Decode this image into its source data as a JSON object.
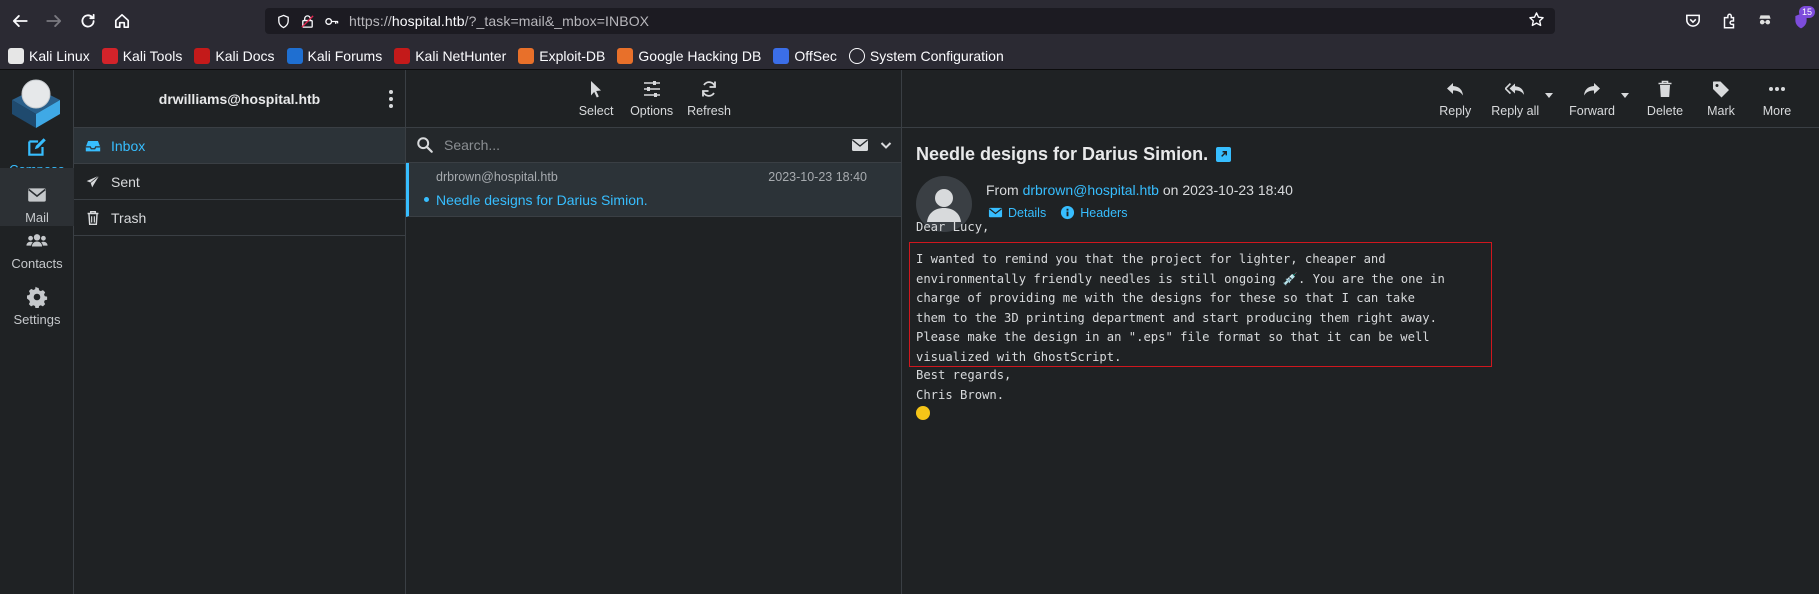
{
  "browser": {
    "url_prefix": "https://",
    "url_host": "hospital.htb",
    "url_path": "/?_task=mail&_mbox=INBOX",
    "extensions_badge": "15",
    "bookmarks": [
      {
        "label": "Kali Linux",
        "color": "#e6e6e6"
      },
      {
        "label": "Kali Tools",
        "color": "#d2232a"
      },
      {
        "label": "Kali Docs",
        "color": "#c41a1a"
      },
      {
        "label": "Kali Forums",
        "color": "#1f6fd1"
      },
      {
        "label": "Kali NetHunter",
        "color": "#c41a1a"
      },
      {
        "label": "Exploit-DB",
        "color": "#e8702a"
      },
      {
        "label": "Google Hacking DB",
        "color": "#e8702a"
      },
      {
        "label": "OffSec",
        "color": "#3b6ee8"
      },
      {
        "label": "System Configuration",
        "color": "#fbfbfe"
      }
    ]
  },
  "rail": {
    "compose": "Compose",
    "mail": "Mail",
    "contacts": "Contacts",
    "settings": "Settings"
  },
  "folders": {
    "account": "drwilliams@hospital.htb",
    "items": [
      {
        "label": "Inbox"
      },
      {
        "label": "Sent"
      },
      {
        "label": "Trash"
      }
    ]
  },
  "list_toolbar": {
    "select": "Select",
    "options": "Options",
    "refresh": "Refresh"
  },
  "search": {
    "placeholder": "Search..."
  },
  "messages": [
    {
      "from": "drbrown@hospital.htb",
      "date": "2023-10-23 18:40",
      "subject": "Needle designs for Darius Simion."
    }
  ],
  "reader_toolbar": {
    "reply": "Reply",
    "reply_all": "Reply all",
    "forward": "Forward",
    "delete": "Delete",
    "mark": "Mark",
    "more": "More"
  },
  "email": {
    "subject": "Needle designs for Darius Simion.",
    "from_prefix": "From",
    "from_addr": "drbrown@hospital.htb",
    "from_on": "on",
    "date": "2023-10-23 18:40",
    "details": "Details",
    "headers": "Headers",
    "greeting": "Dear Lucy,",
    "body": "I wanted to remind you that the project for lighter, cheaper and\nenvironmentally friendly needles is still ongoing 💉. You are the one in\ncharge of providing me with the designs for these so that I can take\nthem to the 3D printing department and start producing them right away.\nPlease make the design in an \".eps\" file format so that it can be well\nvisualized with GhostScript.",
    "closing": "Best regards,\nChris Brown."
  },
  "colors": {
    "accent": "#37beff",
    "highlight_box": "#d0171e"
  }
}
